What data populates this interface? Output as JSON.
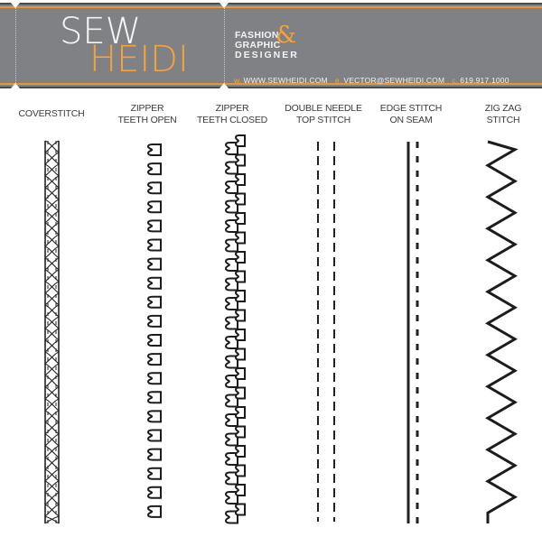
{
  "header": {
    "logo_top": "SEW",
    "logo_bottom": "HEIDI",
    "tagline": [
      "FASHION",
      "GRAPHIC",
      "DESIGNER"
    ],
    "ampersand": "&",
    "contact": [
      {
        "prefix": "w.",
        "value": "WWW.SEWHEIDI.COM"
      },
      {
        "prefix": "e.",
        "value": "VECTOR@SEWHEIDI.COM"
      },
      {
        "prefix": "c.",
        "value": "619.917.1000"
      }
    ],
    "colors": {
      "band": "#808185",
      "accent": "#f2a33a",
      "text": "#f4f4f4"
    }
  },
  "stitches": [
    {
      "id": "coverstitch",
      "label": [
        "COVERSTITCH"
      ]
    },
    {
      "id": "zipper-open",
      "label": [
        "ZIPPER",
        "TEETH OPEN"
      ]
    },
    {
      "id": "zipper-closed",
      "label": [
        "ZIPPER",
        "TEETH CLOSED"
      ]
    },
    {
      "id": "double-needle",
      "label": [
        "DOUBLE NEEDLE",
        "TOP STITCH"
      ]
    },
    {
      "id": "edge-stitch",
      "label": [
        "EDGE STITCH",
        "ON SEAM"
      ]
    },
    {
      "id": "zig-zag",
      "label": [
        "ZIG ZAG",
        "STITCH"
      ]
    }
  ]
}
